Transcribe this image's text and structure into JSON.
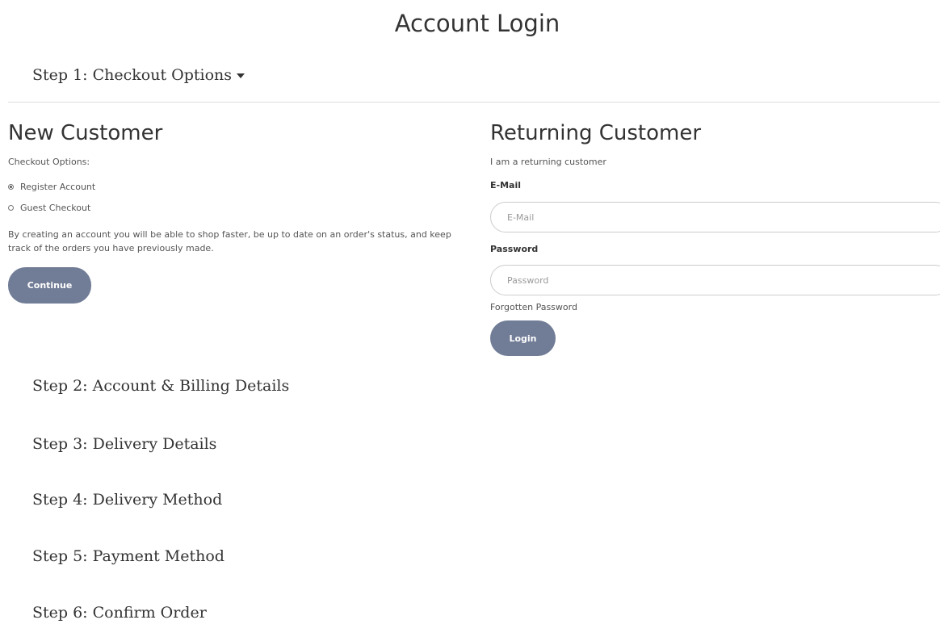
{
  "page": {
    "title": "Account Login"
  },
  "steps": {
    "step1": "Step 1: Checkout Options",
    "step2": "Step 2: Account & Billing Details",
    "step3": "Step 3: Delivery Details",
    "step4": "Step 4: Delivery Method",
    "step5": "Step 5: Payment Method",
    "step6": "Step 6: Confirm Order"
  },
  "new_customer": {
    "heading": "New Customer",
    "options_label": "Checkout Options:",
    "options": [
      {
        "label": "Register Account",
        "selected": true
      },
      {
        "label": "Guest Checkout",
        "selected": false
      }
    ],
    "description": "By creating an account you will be able to shop faster, be up to date on an order's status, and keep track of the orders you have previously made.",
    "continue_label": "Continue"
  },
  "returning_customer": {
    "heading": "Returning Customer",
    "subtext": "I am a returning customer",
    "email_label": "E-Mail",
    "email_placeholder": "E-Mail",
    "email_value": "",
    "password_label": "Password",
    "password_placeholder": "Password",
    "password_value": "",
    "forgotten_label": "Forgotten Password",
    "login_label": "Login"
  },
  "colors": {
    "button_bg": "#717c96",
    "button_text": "#ffffff",
    "divider": "#dddddd",
    "text": "#333333"
  },
  "icons": {
    "step1_toggle": "caret-down-icon"
  }
}
